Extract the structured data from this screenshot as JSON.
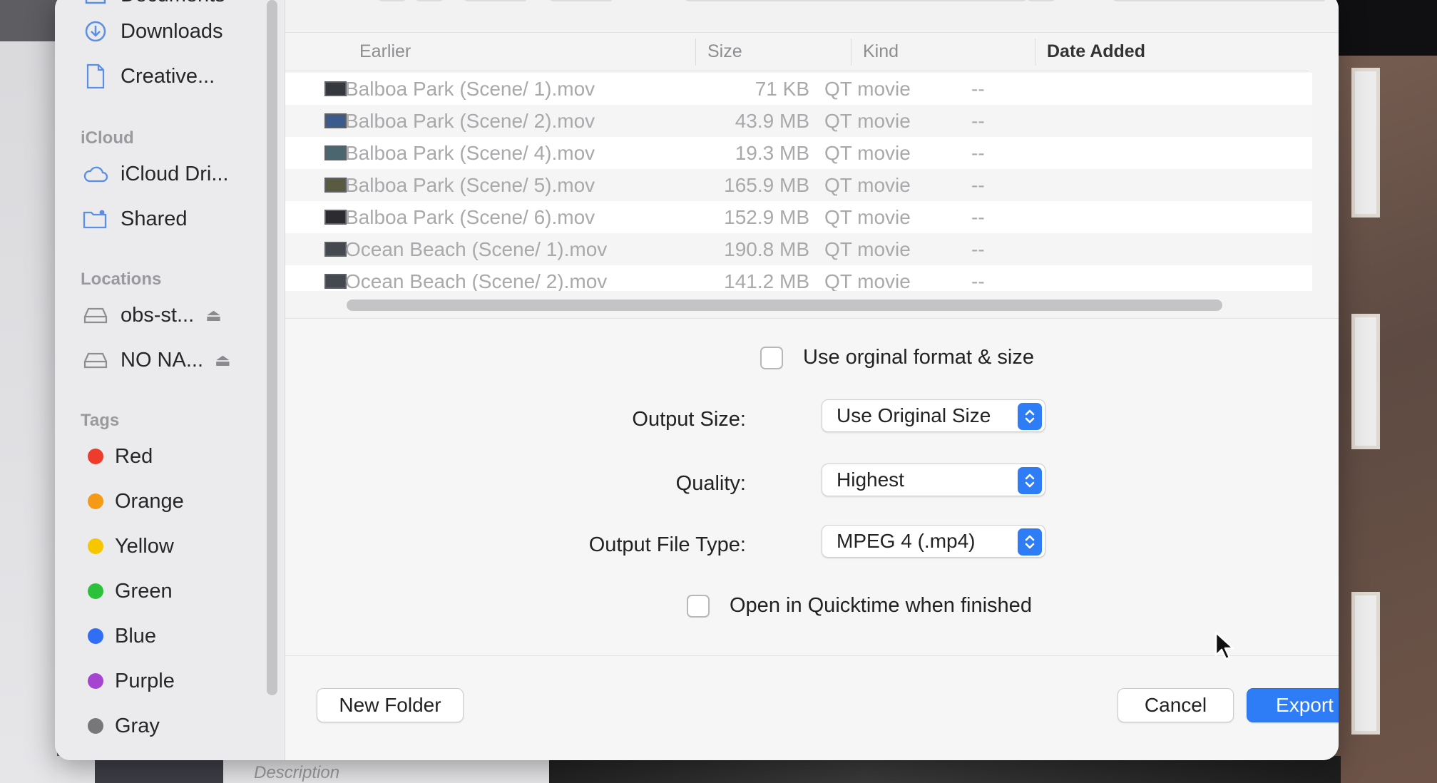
{
  "sidebar": {
    "top_items": [
      {
        "label": "Documents",
        "icon": "document-folder-icon"
      },
      {
        "label": "Downloads",
        "icon": "download-icon"
      },
      {
        "label": "Creative...",
        "icon": "document-icon"
      }
    ],
    "icloud_header": "iCloud",
    "icloud_items": [
      {
        "label": "iCloud Dri...",
        "icon": "cloud-icon"
      },
      {
        "label": "Shared",
        "icon": "shared-folder-icon"
      }
    ],
    "locations_header": "Locations",
    "location_items": [
      {
        "label": "obs-st...",
        "icon": "drive-icon"
      },
      {
        "label": "NO NA...",
        "icon": "drive-icon"
      }
    ],
    "tags_header": "Tags",
    "tags": [
      {
        "label": "Red",
        "color": "#ef3b2c"
      },
      {
        "label": "Orange",
        "color": "#f59a16"
      },
      {
        "label": "Yellow",
        "color": "#f6c700"
      },
      {
        "label": "Green",
        "color": "#2cc13a"
      },
      {
        "label": "Blue",
        "color": "#2f6ef5"
      },
      {
        "label": "Purple",
        "color": "#a644d2"
      },
      {
        "label": "Gray",
        "color": "#777779"
      }
    ]
  },
  "file_list": {
    "columns": [
      "Earlier",
      "Size",
      "Kind",
      "Date Added"
    ],
    "rows": [
      {
        "name": "Balboa Park (Scene/ 1).mov",
        "size": "71 KB",
        "kind": "QT movie",
        "date": "--"
      },
      {
        "name": "Balboa Park (Scene/ 2).mov",
        "size": "43.9 MB",
        "kind": "QT movie",
        "date": "--"
      },
      {
        "name": "Balboa Park (Scene/ 4).mov",
        "size": "19.3 MB",
        "kind": "QT movie",
        "date": "--"
      },
      {
        "name": "Balboa Park (Scene/ 5).mov",
        "size": "165.9 MB",
        "kind": "QT movie",
        "date": "--"
      },
      {
        "name": "Balboa Park (Scene/ 6).mov",
        "size": "152.9 MB",
        "kind": "QT movie",
        "date": "--"
      },
      {
        "name": "Ocean Beach (Scene/ 1).mov",
        "size": "190.8 MB",
        "kind": "QT movie",
        "date": "--"
      },
      {
        "name": "Ocean Beach (Scene/ 2).mov",
        "size": "141.2 MB",
        "kind": "QT movie",
        "date": "--"
      }
    ]
  },
  "options": {
    "use_original_label": "Use orginal format & size",
    "output_size_label": "Output Size:",
    "output_size_value": "Use Original Size",
    "quality_label": "Quality:",
    "quality_value": "Highest",
    "file_type_label": "Output File Type:",
    "file_type_value": "MPEG 4 (.mp4)",
    "open_quicktime_label": "Open in Quicktime when finished"
  },
  "footer": {
    "new_folder": "New Folder",
    "cancel": "Cancel",
    "export": "Export"
  },
  "background": {
    "description_label": "Description"
  },
  "colors": {
    "accent": "#2f7df6"
  }
}
